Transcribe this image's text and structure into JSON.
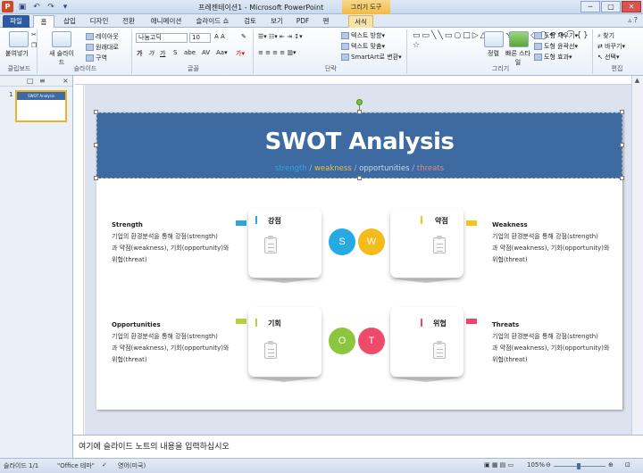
{
  "window": {
    "title": "프레젠테이션1 - Microsoft PowerPoint",
    "context_tab": "그리기 도구",
    "controls": [
      "─",
      "□",
      "✕"
    ]
  },
  "quick_access": {
    "icons": [
      "save-icon",
      "undo-icon",
      "redo-icon",
      "customize-icon"
    ]
  },
  "tabs": [
    "파일",
    "홈",
    "삽입",
    "디자인",
    "전환",
    "애니메이션",
    "슬라이드 쇼",
    "검토",
    "보기",
    "PDF",
    "펜",
    "서식"
  ],
  "ribbon": {
    "clipboard": {
      "paste": "붙여넣기",
      "group": "클립보드"
    },
    "slides": {
      "new": "새 슬라이드",
      "layout": "레이아웃",
      "reset": "원래대로",
      "section": "구역",
      "group": "슬라이드"
    },
    "font": {
      "name": "나눔고딕",
      "size": "10",
      "group": "글꼴"
    },
    "paragraph": {
      "text_direction": "텍스트 방향",
      "align_text": "텍스트 맞춤",
      "smartart": "SmartArt로 변환",
      "group": "단락"
    },
    "drawing": {
      "arrange": "정렬",
      "quick_styles": "빠른 스타일",
      "fill": "도형 채우기",
      "outline": "도형 윤곽선",
      "effects": "도형 효과",
      "group": "그리기"
    },
    "editing": {
      "find": "찾기",
      "replace": "바꾸기",
      "select": "선택",
      "group": "편집"
    }
  },
  "left_pane": {
    "tab_slides": "□",
    "tab_outline": "≡",
    "close": "×",
    "slide_number": "1",
    "thumb_title": "SWOT Analysis"
  },
  "slide": {
    "title": "SWOT Analysis",
    "subtitle": {
      "s": "strength",
      "sep1": "/",
      "w": "weakness",
      "sep2": "/",
      "o": "opportunities",
      "sep3": "/",
      "t": "threats"
    },
    "quadrants": [
      {
        "key": "S",
        "label": "강점",
        "heading": "Strength",
        "lines": [
          "기업의 환경분석을 통해 강점(strength)",
          "과 약점(weakness), 기회(opportunity)와",
          "위협(threat)"
        ],
        "color": "#27a9e1",
        "tag": "#2aa7df"
      },
      {
        "key": "W",
        "label": "약점",
        "heading": "Weakness",
        "lines": [
          "기업의 환경분석을 통해 강점(strength)",
          "과 약점(weakness), 기회(opportunity)와",
          "위협(threat)"
        ],
        "color": "#f3bb1c",
        "tag": "#f0c419"
      },
      {
        "key": "O",
        "label": "기회",
        "heading": "Opportunities",
        "lines": [
          "기업의 환경분석을 통해 강점(strength)",
          "과 약점(weakness), 기회(opportunity)와",
          "위협(threat)"
        ],
        "color": "#8cc63f",
        "tag": "#b5d33a"
      },
      {
        "key": "T",
        "label": "위협",
        "heading": "Threats",
        "lines": [
          "기업의 환경분석을 통해 강점(strength)",
          "과 약점(weakness), 기회(opportunity)와",
          "위협(threat)"
        ],
        "color": "#ef4a6b",
        "tag": "#e8486a"
      }
    ]
  },
  "notes": {
    "placeholder": "여기에 슬라이드 노트의 내용을 입력하십시오"
  },
  "status": {
    "slide": "슬라이드 1/1",
    "theme": "\"Office 테마\"",
    "language": "영어(미국)",
    "zoom": "105%"
  }
}
